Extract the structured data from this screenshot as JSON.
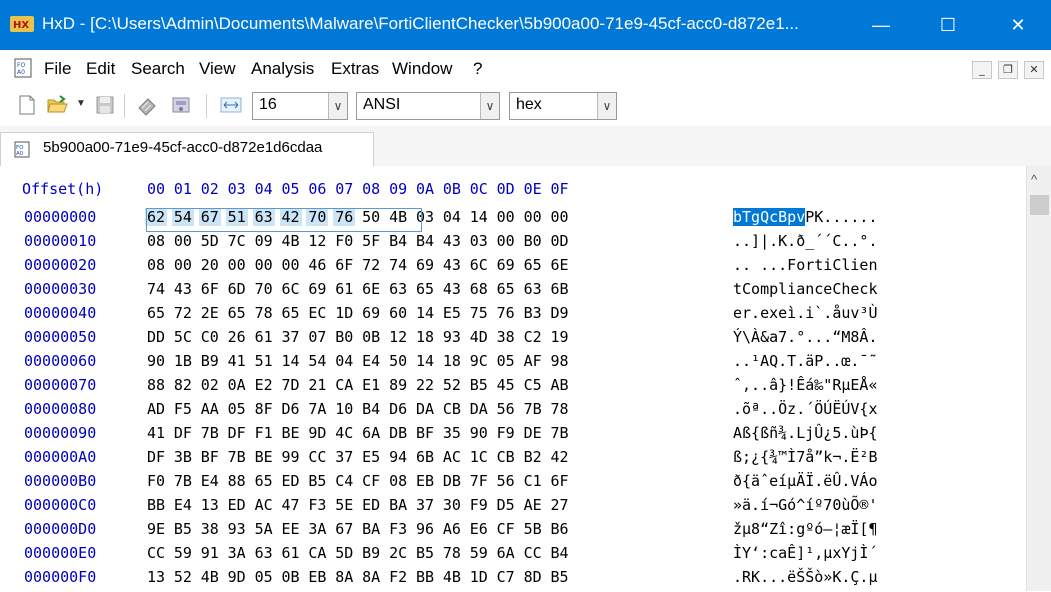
{
  "window": {
    "title": "HxD - [C:\\Users\\Admin\\Documents\\Malware\\FortiClientChecker\\5b900a00-71e9-45cf-acc0-d872e1...",
    "minimize": "—",
    "maximize": "☐",
    "close": "✕"
  },
  "menu": {
    "items": [
      "File",
      "Edit",
      "Search",
      "View",
      "Analysis",
      "Extras",
      "Window",
      "?"
    ],
    "mdi_minimize": "_",
    "mdi_restore": "❐",
    "mdi_close": "✕"
  },
  "toolbar": {
    "bytes_per_row": "16",
    "charset": "ANSI",
    "offset_base": "hex",
    "icons": [
      "new-file-icon",
      "open-file-icon",
      "save-icon",
      "chip-icon",
      "disk-icon",
      "columns-icon"
    ]
  },
  "tab": {
    "label": "5b900a00-71e9-45cf-acc0-d872e1d6cdaa"
  },
  "hex": {
    "offset_header": "Offset(h)",
    "column_headers": [
      "00",
      "01",
      "02",
      "03",
      "04",
      "05",
      "06",
      "07",
      "08",
      "09",
      "0A",
      "0B",
      "0C",
      "0D",
      "0E",
      "0F"
    ],
    "selection": {
      "row": 0,
      "start": 0,
      "end": 7
    },
    "rows": [
      {
        "offset": "00000000",
        "bytes": [
          "62",
          "54",
          "67",
          "51",
          "63",
          "42",
          "70",
          "76",
          "50",
          "4B",
          "03",
          "04",
          "14",
          "00",
          "00",
          "00"
        ],
        "ascii": "bTgQcBpvPK......"
      },
      {
        "offset": "00000010",
        "bytes": [
          "08",
          "00",
          "5D",
          "7C",
          "09",
          "4B",
          "12",
          "F0",
          "5F",
          "B4",
          "B4",
          "43",
          "03",
          "00",
          "B0",
          "0D"
        ],
        "ascii": "..]|.K.ð_´´C..°."
      },
      {
        "offset": "00000020",
        "bytes": [
          "08",
          "00",
          "20",
          "00",
          "00",
          "00",
          "46",
          "6F",
          "72",
          "74",
          "69",
          "43",
          "6C",
          "69",
          "65",
          "6E"
        ],
        "ascii": ".. ...FortiClien"
      },
      {
        "offset": "00000030",
        "bytes": [
          "74",
          "43",
          "6F",
          "6D",
          "70",
          "6C",
          "69",
          "61",
          "6E",
          "63",
          "65",
          "43",
          "68",
          "65",
          "63",
          "6B"
        ],
        "ascii": "tComplianceCheck"
      },
      {
        "offset": "00000040",
        "bytes": [
          "65",
          "72",
          "2E",
          "65",
          "78",
          "65",
          "EC",
          "1D",
          "69",
          "60",
          "14",
          "E5",
          "75",
          "76",
          "B3",
          "D9"
        ],
        "ascii": "er.exeì.i`.åuv³Ù"
      },
      {
        "offset": "00000050",
        "bytes": [
          "DD",
          "5C",
          "C0",
          "26",
          "61",
          "37",
          "07",
          "B0",
          "0B",
          "12",
          "18",
          "93",
          "4D",
          "38",
          "C2",
          "19"
        ],
        "ascii": "Ý\\À&a7.°...“M8Â."
      },
      {
        "offset": "00000060",
        "bytes": [
          "90",
          "1B",
          "B9",
          "41",
          "51",
          "14",
          "54",
          "04",
          "E4",
          "50",
          "14",
          "18",
          "9C",
          "05",
          "AF",
          "98"
        ],
        "ascii": "..¹AQ.T.äP..œ.¯˜"
      },
      {
        "offset": "00000070",
        "bytes": [
          "88",
          "82",
          "02",
          "0A",
          "E2",
          "7D",
          "21",
          "CA",
          "E1",
          "89",
          "22",
          "52",
          "B5",
          "45",
          "C5",
          "AB"
        ],
        "ascii": "ˆ‚..â}!Êá‰\"RµEÅ«"
      },
      {
        "offset": "00000080",
        "bytes": [
          "AD",
          "F5",
          "AA",
          "05",
          "8F",
          "D6",
          "7A",
          "10",
          "B4",
          "D6",
          "DA",
          "CB",
          "DA",
          "56",
          "7B",
          "78"
        ],
        "ascii": ".õª..Öz.´ÖÚËÚV{x"
      },
      {
        "offset": "00000090",
        "bytes": [
          "41",
          "DF",
          "7B",
          "DF",
          "F1",
          "BE",
          "9D",
          "4C",
          "6A",
          "DB",
          "BF",
          "35",
          "90",
          "F9",
          "DE",
          "7B"
        ],
        "ascii": "Aß{ßñ¾.LjÛ¿5.ùÞ{"
      },
      {
        "offset": "000000A0",
        "bytes": [
          "DF",
          "3B",
          "BF",
          "7B",
          "BE",
          "99",
          "CC",
          "37",
          "E5",
          "94",
          "6B",
          "AC",
          "1C",
          "CB",
          "B2",
          "42"
        ],
        "ascii": "ß;¿{¾™Ì7å”k¬.Ë²B"
      },
      {
        "offset": "000000B0",
        "bytes": [
          "F0",
          "7B",
          "E4",
          "88",
          "65",
          "ED",
          "B5",
          "C4",
          "CF",
          "08",
          "EB",
          "DB",
          "7F",
          "56",
          "C1",
          "6F"
        ],
        "ascii": "ð{äˆeíµÄÏ.ëÛ.VÁo"
      },
      {
        "offset": "000000C0",
        "bytes": [
          "BB",
          "E4",
          "13",
          "ED",
          "AC",
          "47",
          "F3",
          "5E",
          "ED",
          "BA",
          "37",
          "30",
          "F9",
          "D5",
          "AE",
          "27"
        ],
        "ascii": "»ä.í¬Gó^íº70ùÕ®'"
      },
      {
        "offset": "000000D0",
        "bytes": [
          "9E",
          "B5",
          "38",
          "93",
          "5A",
          "EE",
          "3A",
          "67",
          "BA",
          "F3",
          "96",
          "A6",
          "E6",
          "CF",
          "5B",
          "B6"
        ],
        "ascii": "žµ8“Zî:gºó–¦æÏ[¶"
      },
      {
        "offset": "000000E0",
        "bytes": [
          "CC",
          "59",
          "91",
          "3A",
          "63",
          "61",
          "CA",
          "5D",
          "B9",
          "2C",
          "B5",
          "78",
          "59",
          "6A",
          "CC",
          "B4"
        ],
        "ascii": "ÌY‘:caÊ]¹,µxYjÌ´"
      },
      {
        "offset": "000000F0",
        "bytes": [
          "13",
          "52",
          "4B",
          "9D",
          "05",
          "0B",
          "EB",
          "8A",
          "8A",
          "F2",
          "BB",
          "4B",
          "1D",
          "C7",
          "8D",
          "B5"
        ],
        "ascii": ".RK...ëŠŠò»K.Ç.µ"
      }
    ]
  },
  "colors": {
    "titlebar": "#0078d7",
    "offset_text": "#0000c0",
    "selection": "#0078d7",
    "hex_selection": "#cce4f7"
  }
}
